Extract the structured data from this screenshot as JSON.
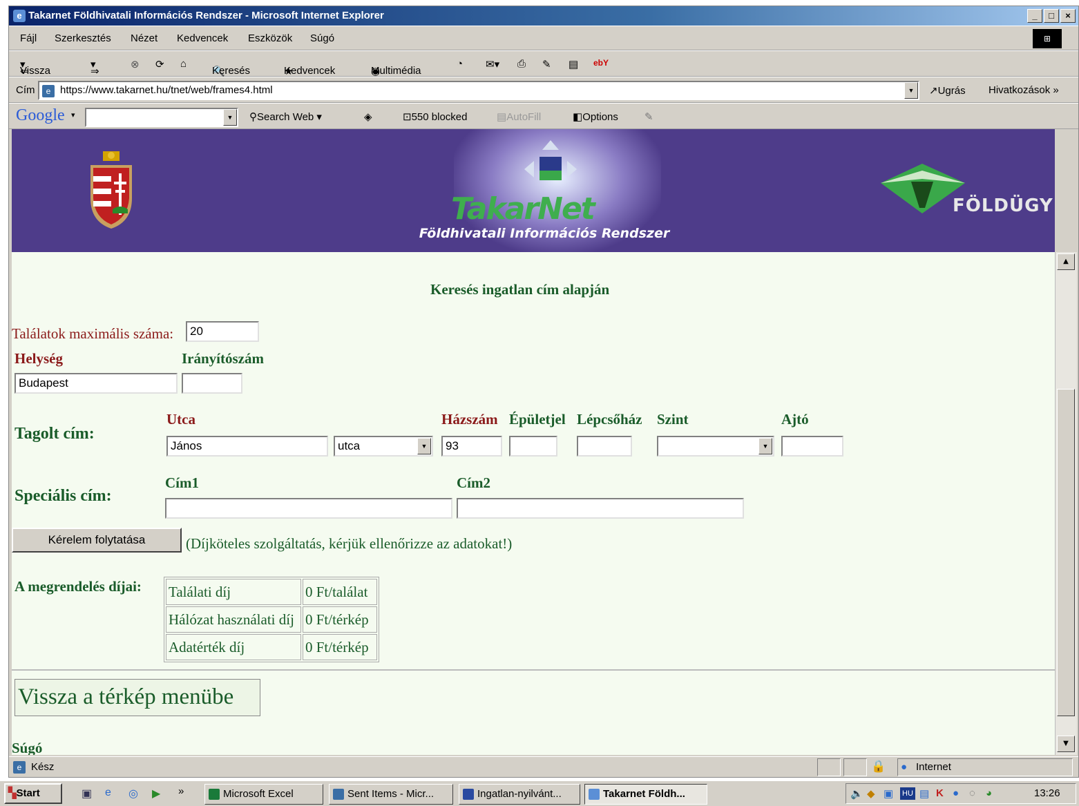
{
  "window": {
    "title": "Takarnet Földhivatali Információs Rendszer - Microsoft Internet Explorer"
  },
  "menu": {
    "items": [
      "Fájl",
      "Szerkesztés",
      "Nézet",
      "Kedvencek",
      "Eszközök",
      "Súgó"
    ]
  },
  "toolbar": {
    "back": "Vissza",
    "search": "Keresés",
    "favorites": "Kedvencek",
    "multimedia": "Multimédia"
  },
  "address": {
    "label": "Cím",
    "url": "https://www.takarnet.hu/tnet/web/frames4.html",
    "go": "Ugrás",
    "links": "Hivatkozások"
  },
  "google": {
    "logo": "Google",
    "search_web": "Search Web",
    "blocked": "550 blocked",
    "autofill": "AutoFill",
    "options": "Options"
  },
  "banner": {
    "logo_text": "TakarNet",
    "subtitle": "Földhivatali Információs Rendszer",
    "right_logo": "FÖLDÜGY"
  },
  "form": {
    "heading": "Keresés ingatlan cím alapján",
    "max_results_label": "Találatok maximális száma:",
    "max_results_value": "20",
    "locality_label": "Helység",
    "locality_value": "Budapest",
    "zip_label": "Irányítószám",
    "zip_value": "",
    "structured_label": "Tagolt cím:",
    "street_label": "Utca",
    "street_value": "János",
    "street_type_value": "utca",
    "house_no_label": "Házszám",
    "house_no_value": "93",
    "building_label": "Épületjel",
    "staircase_label": "Lépcsőház",
    "floor_label": "Szint",
    "door_label": "Ajtó",
    "special_label": "Speciális cím:",
    "addr1_label": "Cím1",
    "addr2_label": "Cím2",
    "continue_button": "Kérelem folytatása",
    "continue_note": "(Díjköteles szolgáltatás, kérjük ellenőrizze az adatokat!)",
    "fees_label": "A megrendelés díjai:",
    "fees": [
      {
        "name": "Találati díj",
        "value": "0 Ft/találat"
      },
      {
        "name": "Hálózat használati díj",
        "value": "0 Ft/térkép"
      },
      {
        "name": "Adatérték díj",
        "value": "0 Ft/térkép"
      }
    ],
    "back_link": "Vissza a térkép menübe",
    "help": "Súgó"
  },
  "status": {
    "text": "Kész",
    "zone": "Internet"
  },
  "taskbar": {
    "start": "Start",
    "tasks": [
      "Microsoft Excel",
      "Sent Items - Micr...",
      "Ingatlan-nyilvánt...",
      "Takarnet Földh..."
    ],
    "clock": "13:26"
  },
  "colors": {
    "banner": "#4e3c8a",
    "green_text": "#1a5c2a",
    "red_text": "#8b1a1a",
    "page_bg": "#f5fbf0"
  }
}
